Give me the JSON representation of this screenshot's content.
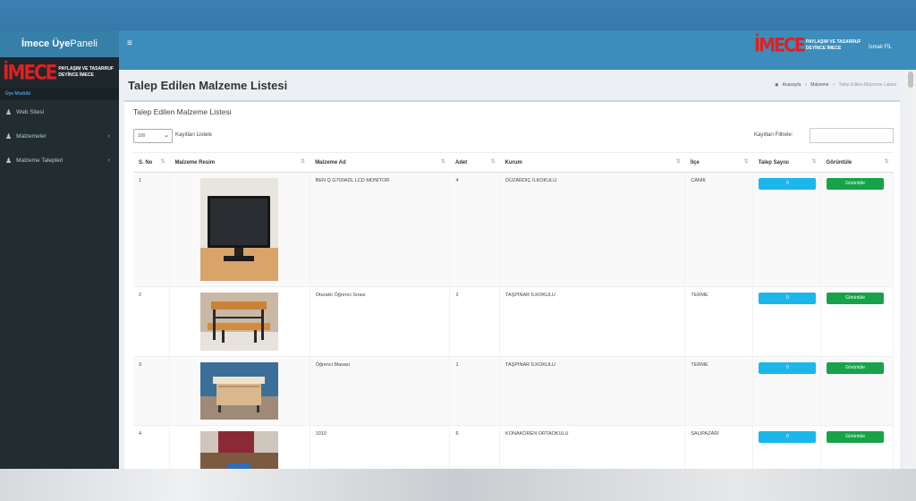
{
  "sidebar": {
    "brand_bold": "İmece Üye",
    "brand_light": "Paneli",
    "logo_mark": "İMECE",
    "logo_line1": "PAYLAŞIM VE TASARRUF",
    "logo_line2": "DEYİNCE İMECE",
    "header": "Üye Modülü",
    "items": [
      {
        "label": "Web Sitesi",
        "icon": "users-icon",
        "has_chevron": false
      },
      {
        "label": "Malzemeler",
        "icon": "users-icon",
        "has_chevron": true
      },
      {
        "label": "Malzeme Talepleri",
        "icon": "users-icon",
        "has_chevron": true
      }
    ]
  },
  "topbar": {
    "menu_icon": "≡",
    "user": "İsmail FİL"
  },
  "page": {
    "title": "Talep Edilen Malzeme Listesi",
    "breadcrumb": [
      "Anasayfa",
      "Malzeme",
      "Talep Edilen Malzeme Listesi"
    ]
  },
  "box": {
    "title": "Talep Edilen Malzeme Listesi",
    "length_value": "100",
    "length_label": "Kayıtları Listele",
    "filter_label": "Kayıtları Filtrele:",
    "filter_value": ""
  },
  "table": {
    "columns": [
      "S. No",
      "Malzeme Resim",
      "Malzeme Ad",
      "Adet",
      "Kurum",
      "İlçe",
      "Talep Sayısı",
      "Görüntüle"
    ],
    "rows": [
      {
        "no": "1",
        "image": "monitor",
        "name": "BEN Q G700ADL LCD MONİTOR",
        "qty": "4",
        "school": "DÜZARDIÇ İLKOKULU",
        "district": "CANİK",
        "requests": "0",
        "view": "Görüntüle"
      },
      {
        "no": "2",
        "image": "student-bench",
        "name": "Oturaklı Öğrenci Sırası",
        "qty": "2",
        "school": "TAŞPINAR İLKOKULU",
        "district": "TERME",
        "requests": "0",
        "view": "Görüntüle"
      },
      {
        "no": "3",
        "image": "student-desk",
        "name": "Öğrenci Masası",
        "qty": "1",
        "school": "TAŞPINAR İLKOKULU",
        "district": "TERME",
        "requests": "0",
        "view": "Görüntüle"
      },
      {
        "no": "4",
        "image": "table-chair",
        "name": "1010",
        "qty": "6",
        "school": "KONAKÖREN ORTAOKULU",
        "district": "SALIPAZARI",
        "requests": "0",
        "view": "Görüntüle"
      }
    ]
  },
  "colors": {
    "topbar": "#3c8dbc",
    "sidebar": "#222d32",
    "request_badge": "#1bb7ea",
    "view_button": "#16a34a"
  }
}
